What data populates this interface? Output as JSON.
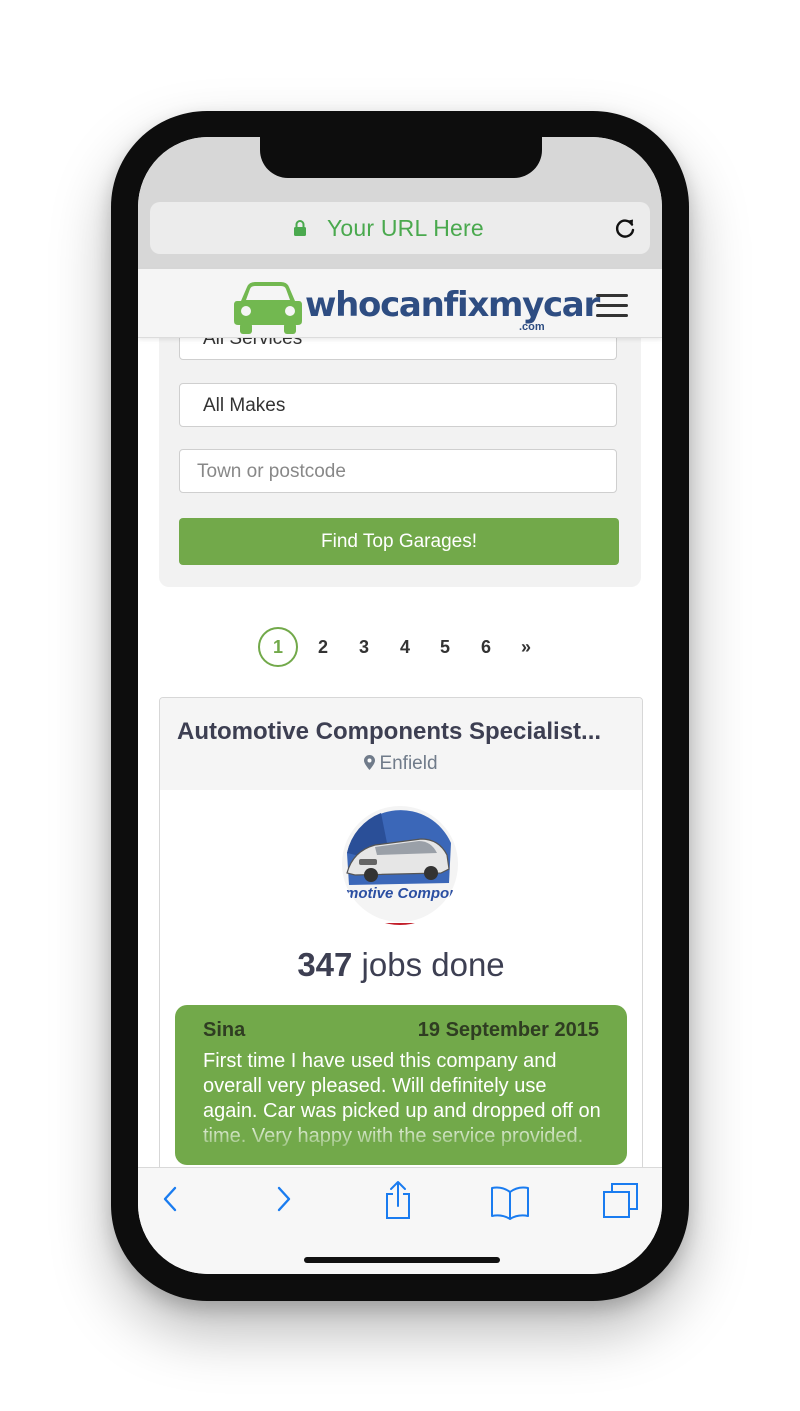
{
  "browser": {
    "url_text": "Your URL Here"
  },
  "site": {
    "logo_text": "whocanfixmycar",
    "logo_suffix": ".com"
  },
  "search": {
    "service_select": "All Services",
    "make_select": "All Makes",
    "location_placeholder": "Town or postcode",
    "submit_label": "Find Top Garages!"
  },
  "pagination": {
    "pages": [
      "1",
      "2",
      "3",
      "4",
      "5",
      "6"
    ],
    "current": "1",
    "next_label": "»"
  },
  "listing": {
    "title": "Automotive Components Specialist...",
    "location": "Enfield",
    "logo_text": "Automotive Components",
    "jobs_count": "347",
    "jobs_label": "jobs done",
    "review": {
      "author": "Sina",
      "date": "19 September 2015",
      "text": "First time I have used this company and overall very pleased. Will definitely use again. Car was picked up and dropped off on time. Very happy with the service provided."
    }
  },
  "colors": {
    "brand_green": "#72a94a",
    "url_green": "#4aa94e",
    "brand_blue": "#2e4d82",
    "ios_blue": "#1a7cf0"
  },
  "icons": [
    "lock-icon",
    "reload-icon",
    "car-logo-icon",
    "menu-icon",
    "map-pin-icon",
    "back-icon",
    "forward-icon",
    "share-icon",
    "bookmarks-icon",
    "tabs-icon"
  ]
}
